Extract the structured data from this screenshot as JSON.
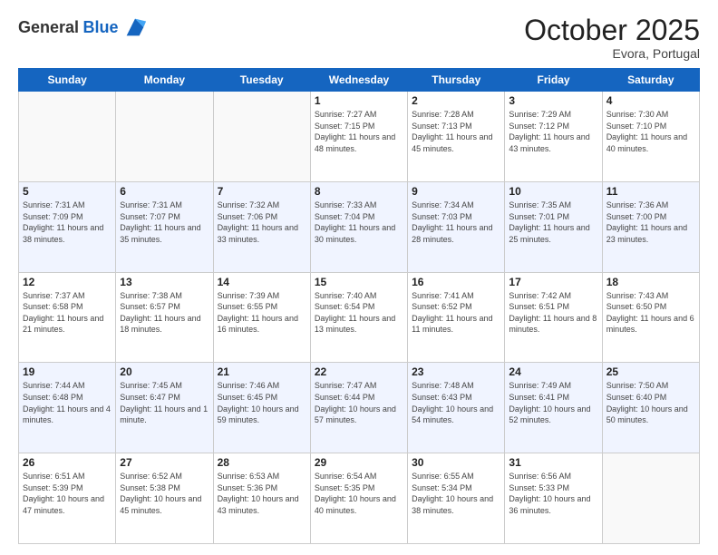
{
  "logo": {
    "general": "General",
    "blue": "Blue"
  },
  "header": {
    "month": "October 2025",
    "location": "Evora, Portugal"
  },
  "weekdays": [
    "Sunday",
    "Monday",
    "Tuesday",
    "Wednesday",
    "Thursday",
    "Friday",
    "Saturday"
  ],
  "weeks": [
    [
      {
        "day": "",
        "sunrise": "",
        "sunset": "",
        "daylight": ""
      },
      {
        "day": "",
        "sunrise": "",
        "sunset": "",
        "daylight": ""
      },
      {
        "day": "",
        "sunrise": "",
        "sunset": "",
        "daylight": ""
      },
      {
        "day": "1",
        "sunrise": "Sunrise: 7:27 AM",
        "sunset": "Sunset: 7:15 PM",
        "daylight": "Daylight: 11 hours and 48 minutes."
      },
      {
        "day": "2",
        "sunrise": "Sunrise: 7:28 AM",
        "sunset": "Sunset: 7:13 PM",
        "daylight": "Daylight: 11 hours and 45 minutes."
      },
      {
        "day": "3",
        "sunrise": "Sunrise: 7:29 AM",
        "sunset": "Sunset: 7:12 PM",
        "daylight": "Daylight: 11 hours and 43 minutes."
      },
      {
        "day": "4",
        "sunrise": "Sunrise: 7:30 AM",
        "sunset": "Sunset: 7:10 PM",
        "daylight": "Daylight: 11 hours and 40 minutes."
      }
    ],
    [
      {
        "day": "5",
        "sunrise": "Sunrise: 7:31 AM",
        "sunset": "Sunset: 7:09 PM",
        "daylight": "Daylight: 11 hours and 38 minutes."
      },
      {
        "day": "6",
        "sunrise": "Sunrise: 7:31 AM",
        "sunset": "Sunset: 7:07 PM",
        "daylight": "Daylight: 11 hours and 35 minutes."
      },
      {
        "day": "7",
        "sunrise": "Sunrise: 7:32 AM",
        "sunset": "Sunset: 7:06 PM",
        "daylight": "Daylight: 11 hours and 33 minutes."
      },
      {
        "day": "8",
        "sunrise": "Sunrise: 7:33 AM",
        "sunset": "Sunset: 7:04 PM",
        "daylight": "Daylight: 11 hours and 30 minutes."
      },
      {
        "day": "9",
        "sunrise": "Sunrise: 7:34 AM",
        "sunset": "Sunset: 7:03 PM",
        "daylight": "Daylight: 11 hours and 28 minutes."
      },
      {
        "day": "10",
        "sunrise": "Sunrise: 7:35 AM",
        "sunset": "Sunset: 7:01 PM",
        "daylight": "Daylight: 11 hours and 25 minutes."
      },
      {
        "day": "11",
        "sunrise": "Sunrise: 7:36 AM",
        "sunset": "Sunset: 7:00 PM",
        "daylight": "Daylight: 11 hours and 23 minutes."
      }
    ],
    [
      {
        "day": "12",
        "sunrise": "Sunrise: 7:37 AM",
        "sunset": "Sunset: 6:58 PM",
        "daylight": "Daylight: 11 hours and 21 minutes."
      },
      {
        "day": "13",
        "sunrise": "Sunrise: 7:38 AM",
        "sunset": "Sunset: 6:57 PM",
        "daylight": "Daylight: 11 hours and 18 minutes."
      },
      {
        "day": "14",
        "sunrise": "Sunrise: 7:39 AM",
        "sunset": "Sunset: 6:55 PM",
        "daylight": "Daylight: 11 hours and 16 minutes."
      },
      {
        "day": "15",
        "sunrise": "Sunrise: 7:40 AM",
        "sunset": "Sunset: 6:54 PM",
        "daylight": "Daylight: 11 hours and 13 minutes."
      },
      {
        "day": "16",
        "sunrise": "Sunrise: 7:41 AM",
        "sunset": "Sunset: 6:52 PM",
        "daylight": "Daylight: 11 hours and 11 minutes."
      },
      {
        "day": "17",
        "sunrise": "Sunrise: 7:42 AM",
        "sunset": "Sunset: 6:51 PM",
        "daylight": "Daylight: 11 hours and 8 minutes."
      },
      {
        "day": "18",
        "sunrise": "Sunrise: 7:43 AM",
        "sunset": "Sunset: 6:50 PM",
        "daylight": "Daylight: 11 hours and 6 minutes."
      }
    ],
    [
      {
        "day": "19",
        "sunrise": "Sunrise: 7:44 AM",
        "sunset": "Sunset: 6:48 PM",
        "daylight": "Daylight: 11 hours and 4 minutes."
      },
      {
        "day": "20",
        "sunrise": "Sunrise: 7:45 AM",
        "sunset": "Sunset: 6:47 PM",
        "daylight": "Daylight: 11 hours and 1 minute."
      },
      {
        "day": "21",
        "sunrise": "Sunrise: 7:46 AM",
        "sunset": "Sunset: 6:45 PM",
        "daylight": "Daylight: 10 hours and 59 minutes."
      },
      {
        "day": "22",
        "sunrise": "Sunrise: 7:47 AM",
        "sunset": "Sunset: 6:44 PM",
        "daylight": "Daylight: 10 hours and 57 minutes."
      },
      {
        "day": "23",
        "sunrise": "Sunrise: 7:48 AM",
        "sunset": "Sunset: 6:43 PM",
        "daylight": "Daylight: 10 hours and 54 minutes."
      },
      {
        "day": "24",
        "sunrise": "Sunrise: 7:49 AM",
        "sunset": "Sunset: 6:41 PM",
        "daylight": "Daylight: 10 hours and 52 minutes."
      },
      {
        "day": "25",
        "sunrise": "Sunrise: 7:50 AM",
        "sunset": "Sunset: 6:40 PM",
        "daylight": "Daylight: 10 hours and 50 minutes."
      }
    ],
    [
      {
        "day": "26",
        "sunrise": "Sunrise: 6:51 AM",
        "sunset": "Sunset: 5:39 PM",
        "daylight": "Daylight: 10 hours and 47 minutes."
      },
      {
        "day": "27",
        "sunrise": "Sunrise: 6:52 AM",
        "sunset": "Sunset: 5:38 PM",
        "daylight": "Daylight: 10 hours and 45 minutes."
      },
      {
        "day": "28",
        "sunrise": "Sunrise: 6:53 AM",
        "sunset": "Sunset: 5:36 PM",
        "daylight": "Daylight: 10 hours and 43 minutes."
      },
      {
        "day": "29",
        "sunrise": "Sunrise: 6:54 AM",
        "sunset": "Sunset: 5:35 PM",
        "daylight": "Daylight: 10 hours and 40 minutes."
      },
      {
        "day": "30",
        "sunrise": "Sunrise: 6:55 AM",
        "sunset": "Sunset: 5:34 PM",
        "daylight": "Daylight: 10 hours and 38 minutes."
      },
      {
        "day": "31",
        "sunrise": "Sunrise: 6:56 AM",
        "sunset": "Sunset: 5:33 PM",
        "daylight": "Daylight: 10 hours and 36 minutes."
      },
      {
        "day": "",
        "sunrise": "",
        "sunset": "",
        "daylight": ""
      }
    ]
  ]
}
